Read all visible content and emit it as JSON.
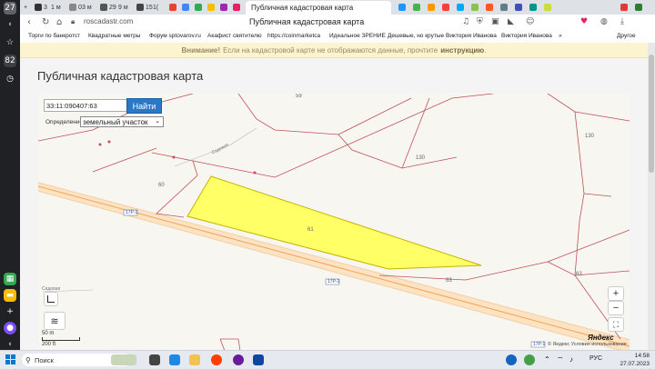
{
  "rail": {
    "badge": "27",
    "badge2": "82"
  },
  "tabs": [
    {
      "label": "3"
    },
    {
      "label": "1 м"
    },
    {
      "label": "0"
    },
    {
      "label": "3 м"
    },
    {
      "label": "29"
    },
    {
      "label": "9 м"
    },
    {
      "label": "15"
    },
    {
      "label": "1("
    }
  ],
  "active_tab": {
    "label": "Публичная кадастровая карта"
  },
  "address_bar": {
    "url": "roscadastr.com",
    "title": "Публичная кадастровая карта"
  },
  "bookmarks": [
    "Торги по банкротст",
    "Квадратные метры",
    "Форум sptovarov.ru",
    "Акафист святителю",
    "https://coinmarketca",
    "Идеальное ЗРЕНИЕ",
    "Дешевые, но крутые",
    "Виктория Иванова",
    "Виктория Иванова",
    "»",
    "Другое"
  ],
  "warning": {
    "prefix": "Внимание!",
    "text": "Если на кадастровой карте не отображаются данные, прочтите",
    "link": "инструкцию"
  },
  "heading": "Публичная кадастровая карта",
  "map": {
    "search_value": "33:11:090407:63",
    "find_button": "Найти",
    "definition_label": "Определение",
    "definition_value": "земельный участок",
    "zoom_in": "+",
    "zoom_out": "−",
    "scale_m": "50 m",
    "scale_ft": "200 ft",
    "logo": "Яндекс",
    "terms": "© Яндекс Условия использования",
    "road_code": "17Р-1",
    "parcel_label": "61",
    "labels": {
      "l59": "59",
      "l130a": "130",
      "l130b": "130",
      "l60": "60",
      "l63a": "63",
      "l63b": "63"
    },
    "street_labels": {
      "s1": "Садовая",
      "s2": "Садовая"
    }
  },
  "taskbar": {
    "search_placeholder": "Поиск",
    "lang": "РУС",
    "time": "14:58",
    "date": "27.07.2023"
  },
  "colors": {
    "parcel_fill": "#ffff66",
    "boundary": "#c0505a",
    "find_button": "#2a78c7"
  }
}
